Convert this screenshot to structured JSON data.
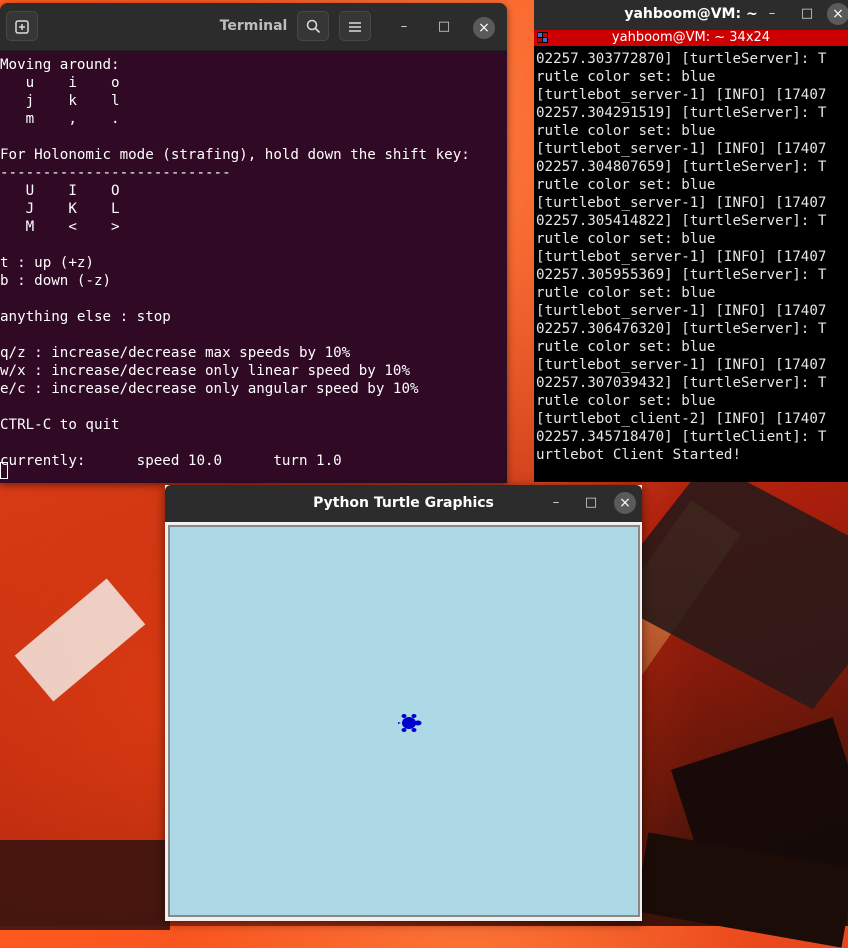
{
  "wallpaper": {
    "accent": "#e0401a"
  },
  "terminal": {
    "title": "Terminal",
    "new_tab_icon": "new-tab-icon",
    "search_icon": "search-icon",
    "menu_icon": "hamburger-menu-icon",
    "min_label": "–",
    "max_label": "□",
    "close_label": "×",
    "background": "#300a24",
    "output": "Moving around:\n   u    i    o\n   j    k    l\n   m    ,    .\n\nFor Holonomic mode (strafing), hold down the shift key:\n---------------------------\n   U    I    O\n   J    K    L\n   M    <    >\n\nt : up (+z)\nb : down (-z)\n\nanything else : stop\n\nq/z : increase/decrease max speeds by 10%\nw/x : increase/decrease only linear speed by 10%\ne/c : increase/decrease only angular speed by 10%\n\nCTRL-C to quit\n\ncurrently:      speed 10.0      turn 1.0"
  },
  "xterm": {
    "title": "yahboom@VM: ~",
    "subtitle": "yahboom@VM: ~ 34x24",
    "min_label": "–",
    "max_label": "□",
    "close_label": "×",
    "output": "02257.303772870] [turtleServer]: T\nrutle color set: blue\n[turtlebot_server-1] [INFO] [17407\n02257.304291519] [turtleServer]: T\nrutle color set: blue\n[turtlebot_server-1] [INFO] [17407\n02257.304807659] [turtleServer]: T\nrutle color set: blue\n[turtlebot_server-1] [INFO] [17407\n02257.305414822] [turtleServer]: T\nrutle color set: blue\n[turtlebot_server-1] [INFO] [17407\n02257.305955369] [turtleServer]: T\nrutle color set: blue\n[turtlebot_server-1] [INFO] [17407\n02257.306476320] [turtleServer]: T\nrutle color set: blue\n[turtlebot_server-1] [INFO] [17407\n02257.307039432] [turtleServer]: T\nrutle color set: blue\n[turtlebot_client-2] [INFO] [17407\n02257.345718470] [turtleClient]: T\nurtlebot Client Started!"
  },
  "turtle_window": {
    "title": "Python Turtle Graphics",
    "min_label": "–",
    "max_label": "□",
    "close_label": "×",
    "canvas_color": "#add8e6",
    "turtle_color": "#0000cc"
  }
}
